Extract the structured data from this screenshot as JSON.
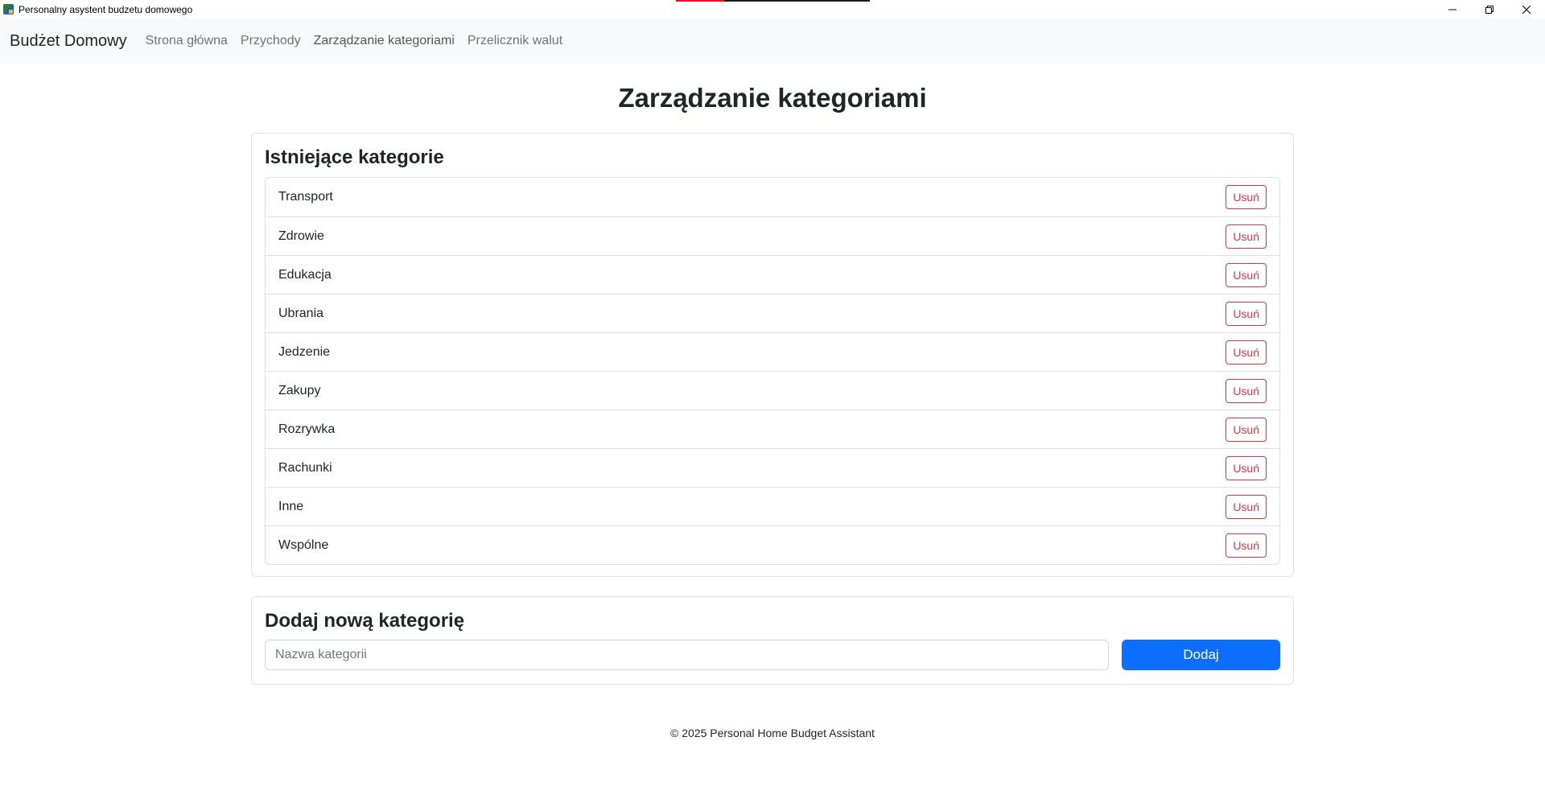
{
  "window": {
    "title": "Personalny asystent budzetu domowego",
    "controls": {
      "minimize_icon": "minimize-icon",
      "restore_icon": "restore-icon",
      "close_icon": "close-icon"
    },
    "progress_fraction": 0.25,
    "colors": {
      "progress_fill": "#e81123"
    }
  },
  "navbar": {
    "brand": "Budżet Domowy",
    "links": [
      {
        "label": "Strona główna"
      },
      {
        "label": "Przychody"
      },
      {
        "label": "Zarządzanie kategoriami"
      },
      {
        "label": "Przelicznik walut"
      }
    ]
  },
  "page": {
    "title": "Zarządzanie kategoriami"
  },
  "existing": {
    "heading": "Istniejące kategorie",
    "delete_label": "Usuń",
    "categories": [
      "Transport",
      "Zdrowie",
      "Edukacja",
      "Ubrania",
      "Jedzenie",
      "Zakupy",
      "Rozrywka",
      "Rachunki",
      "Inne",
      "Wspólne"
    ]
  },
  "add": {
    "heading": "Dodaj nową kategorię",
    "input_value": "",
    "input_placeholder": "Nazwa kategorii",
    "button_label": "Dodaj"
  },
  "footer": {
    "text": "© 2025 Personal Home Budget Assistant"
  },
  "colors": {
    "primary": "#0d6efd",
    "danger": "#dc3545",
    "navbar_bg": "#f8f9fa"
  }
}
